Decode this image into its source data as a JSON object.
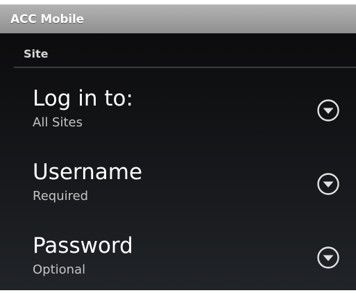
{
  "app": {
    "title": "ACC Mobile"
  },
  "section": {
    "label": "Site"
  },
  "preferences": [
    {
      "title": "Log in to:",
      "summary": "All Sites",
      "icon": "chevron-down-circle-icon"
    },
    {
      "title": "Username",
      "summary": "Required",
      "icon": "chevron-down-circle-icon"
    },
    {
      "title": "Password",
      "summary": "Optional",
      "icon": "chevron-down-circle-icon"
    }
  ],
  "colors": {
    "titlebar": "#a3a3a3",
    "background": "#16181b",
    "title_text": "#ffffff",
    "summary_text": "#c4c4c4",
    "divider": "#3b3d40"
  }
}
